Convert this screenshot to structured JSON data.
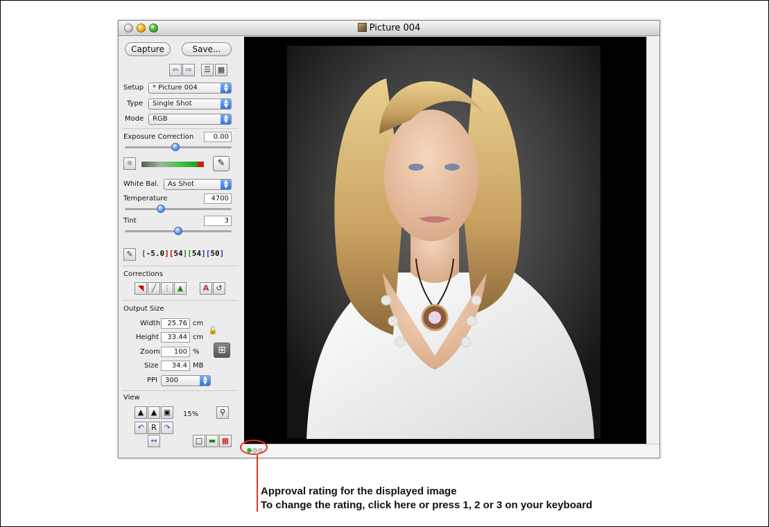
{
  "window": {
    "title": "Picture 004"
  },
  "toolbar": {
    "capture_label": "Capture",
    "save_label": "Save..."
  },
  "setup": {
    "label": "Setup",
    "value": "* Picture 004"
  },
  "type": {
    "label": "Type",
    "value": "Single Shot"
  },
  "mode": {
    "label": "Mode",
    "value": "RGB"
  },
  "exposure": {
    "label": "Exposure Correction",
    "value": "0.00"
  },
  "white_balance": {
    "label": "White Bal.",
    "value": "As Shot"
  },
  "temperature": {
    "label": "Temperature",
    "value": "4700"
  },
  "tint": {
    "label": "Tint",
    "value": "3"
  },
  "readout": {
    "v1": "-5.0",
    "v2": "54",
    "v3": "54",
    "v4": "50"
  },
  "corrections": {
    "label": "Corrections"
  },
  "output": {
    "label": "Output Size",
    "width_label": "Width",
    "width": "25.76",
    "width_unit": "cm",
    "height_label": "Height",
    "height": "33.44",
    "height_unit": "cm",
    "zoom_label": "Zoom",
    "zoom": "100",
    "zoom_unit": "%",
    "size_label": "Size",
    "size": "34.4",
    "size_unit": "MB",
    "ppi_label": "PPI",
    "ppi": "300"
  },
  "view": {
    "label": "View",
    "zoom": "15%",
    "r_label": "R"
  },
  "annotation": {
    "line1": "Approval rating for the displayed image",
    "line2": "To change the rating, click here or press 1, 2 or 3 on your keyboard"
  },
  "colors": {
    "accent": "#2e6fe0",
    "annotation": "#e23421",
    "rating_on": "#3cae3a"
  }
}
